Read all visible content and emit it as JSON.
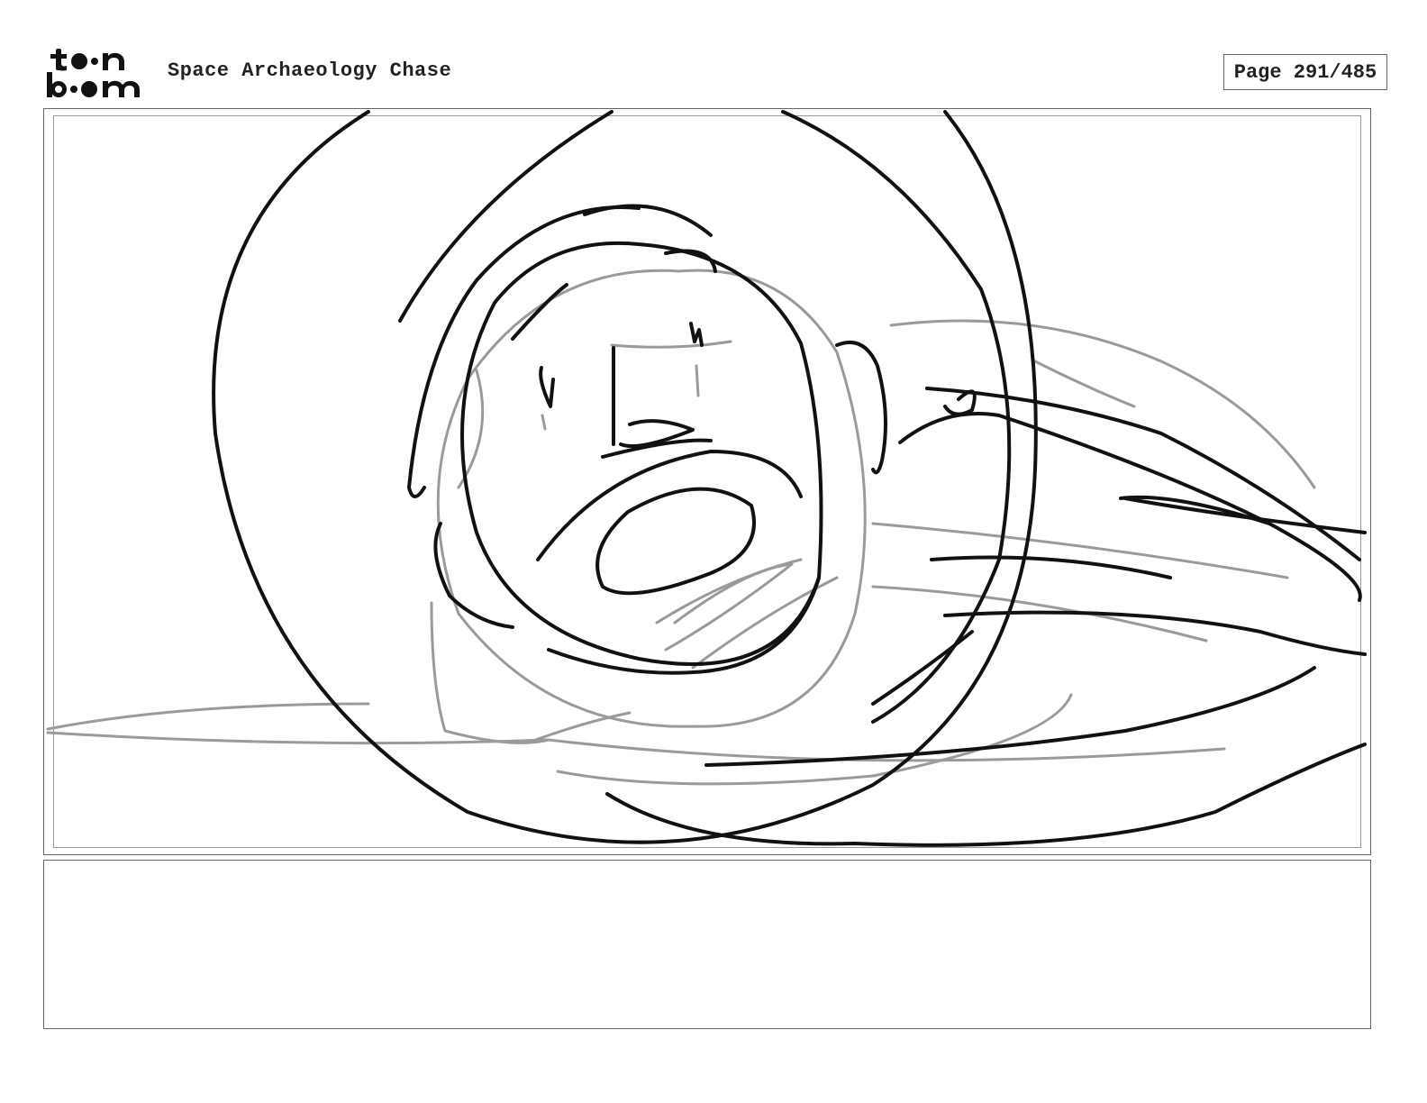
{
  "header": {
    "logo_text": "toon boom",
    "project_title": "Space Archaeology Chase",
    "page_label": "Page 291/485"
  },
  "panel": {
    "sketch_subject": "astronaut-helmet-sketch"
  },
  "notes": {
    "text": ""
  }
}
